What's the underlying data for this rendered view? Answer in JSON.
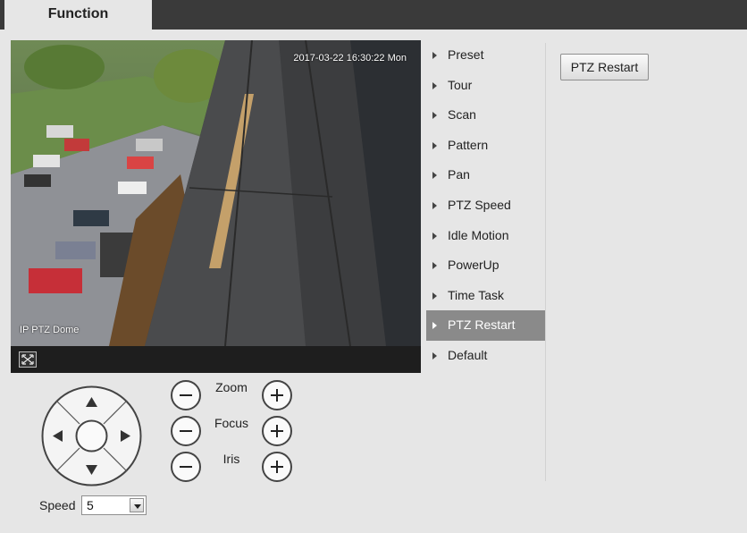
{
  "tabs": [
    {
      "label": "Function"
    }
  ],
  "video": {
    "timestamp": "2017-03-22 16:30:22 Mon",
    "channel_name": "IP PTZ Dome"
  },
  "menu": {
    "items": [
      {
        "label": "Preset"
      },
      {
        "label": "Tour"
      },
      {
        "label": "Scan"
      },
      {
        "label": "Pattern"
      },
      {
        "label": "Pan"
      },
      {
        "label": "PTZ Speed"
      },
      {
        "label": "Idle Motion"
      },
      {
        "label": "PowerUp"
      },
      {
        "label": "Time Task"
      },
      {
        "label": "PTZ Restart"
      },
      {
        "label": "Default"
      }
    ],
    "active": "PTZ Restart"
  },
  "panel": {
    "restart_button": "PTZ Restart"
  },
  "controls": {
    "zoom_label": "Zoom",
    "focus_label": "Focus",
    "iris_label": "Iris",
    "speed_label": "Speed",
    "speed_value": "5"
  },
  "icons": {
    "menu_arrow": "triangle-right-icon",
    "fullscreen": "fullscreen-icon",
    "up": "arrow-up-icon",
    "down": "arrow-down-icon",
    "left": "arrow-left-icon",
    "right": "arrow-right-icon",
    "minus": "minus-icon",
    "plus": "plus-icon",
    "dropdown": "chevron-down-icon"
  },
  "colors": {
    "topbar": "#3a3a3a",
    "background": "#e6e6e6",
    "active_item": "#8a8a8a"
  }
}
